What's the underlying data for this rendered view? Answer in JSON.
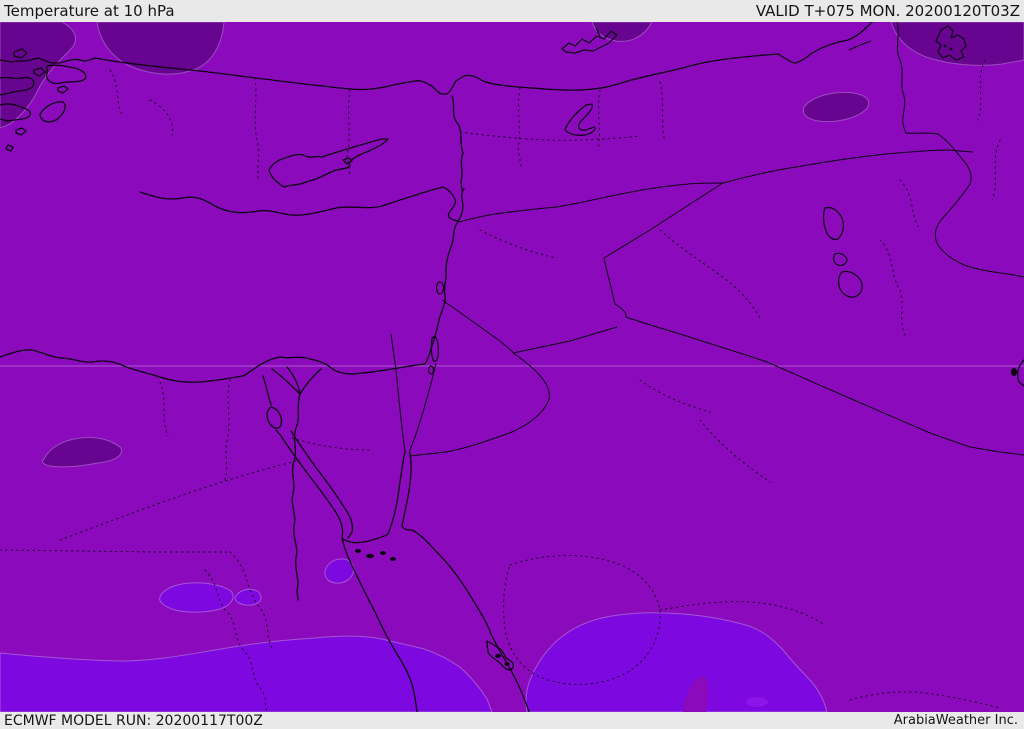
{
  "header": {
    "title": "Temperature at 10 hPa",
    "valid": "VALID T+075 MON. 20200120T03Z"
  },
  "footer": {
    "model_run": "ECMWF MODEL RUN: 20200117T00Z",
    "branding": "ArabiaWeather Inc."
  },
  "map": {
    "colors": {
      "map_main": "#8a0abc",
      "map_dark": "#670490",
      "map_bright": "#7d08e0",
      "map_brighter": "#8d15ea",
      "contour_edge": "#c9a0dd",
      "gridline": "#e0b8e8",
      "line_color": "#0d0112",
      "bar_bg": "#e9e9e9",
      "bar_text": "#151515"
    }
  }
}
